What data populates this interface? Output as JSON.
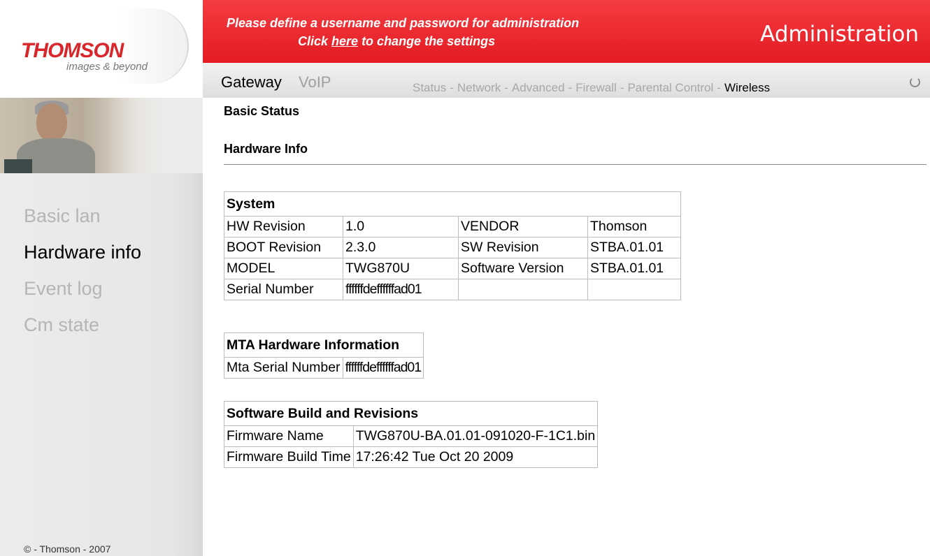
{
  "logo": {
    "brand": "THOMSON",
    "tagline": "images & beyond"
  },
  "banner": {
    "line1": "Please define a username and password for administration",
    "line2_pre": "Click ",
    "line2_link": "here",
    "line2_post": " to change the settings",
    "title": "Administration"
  },
  "nav": {
    "tabs": [
      {
        "label": "Gateway",
        "active": true
      },
      {
        "label": "VoIP",
        "active": false
      }
    ],
    "subnav": [
      "Status",
      "Network",
      "Advanced",
      "Firewall",
      "Parental Control",
      "Wireless"
    ],
    "subnav_separator": "-"
  },
  "sidebar": {
    "items": [
      {
        "label": "Basic lan",
        "active": false
      },
      {
        "label": "Hardware info",
        "active": true
      },
      {
        "label": "Event log",
        "active": false
      },
      {
        "label": "Cm state",
        "active": false
      }
    ],
    "copyright": "© - Thomson - 2007"
  },
  "main": {
    "page_title": "Basic Status",
    "section_title": "Hardware Info",
    "system": {
      "header": "System",
      "rows": [
        [
          "HW Revision",
          "1.0",
          "VENDOR",
          "Thomson"
        ],
        [
          "BOOT Revision",
          "2.3.0",
          "SW Revision",
          "STBA.01.01"
        ],
        [
          "MODEL",
          "TWG870U",
          "Software Version",
          "STBA.01.01"
        ],
        [
          "Serial Number",
          "ffffffdeffffffad01",
          "",
          ""
        ]
      ]
    },
    "mta": {
      "header": "MTA Hardware Information",
      "rows": [
        [
          "Mta Serial Number",
          "ffffffdeffffffad01"
        ]
      ]
    },
    "software": {
      "header": "Software Build and Revisions",
      "rows": [
        [
          "Firmware Name",
          "TWG870U-BA.01.01-091020-F-1C1.bin"
        ],
        [
          "Firmware Build Time",
          "17:26:42 Tue Oct 20 2009"
        ]
      ]
    }
  },
  "colors": {
    "banner_red": "#e31b22",
    "logo_red": "#d8262b",
    "inactive_gray": "#b5b5b5"
  }
}
